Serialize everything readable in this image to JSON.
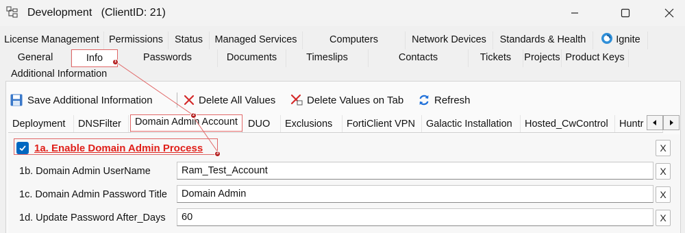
{
  "window": {
    "title": "Development   (ClientID: 21)",
    "app_icon": "tree-icon",
    "controls": [
      "minimize-icon",
      "maximize-icon",
      "close-icon"
    ]
  },
  "tabs_row1": [
    {
      "label": "License Management"
    },
    {
      "label": "Permissions"
    },
    {
      "label": "Status"
    },
    {
      "label": "Managed Services"
    },
    {
      "label": "Computers"
    },
    {
      "label": "Network Devices"
    },
    {
      "label": "Standards & Health"
    },
    {
      "label": "Ignite",
      "icon": "ignite-icon"
    }
  ],
  "tabs_row2": [
    {
      "label": "General"
    },
    {
      "label": "Info",
      "active": true
    },
    {
      "label": "Passwords"
    },
    {
      "label": "Documents"
    },
    {
      "label": "Timeslips"
    },
    {
      "label": "Contacts"
    },
    {
      "label": "Tickets"
    },
    {
      "label": "Projects"
    },
    {
      "label": "Product Keys"
    }
  ],
  "group_label": "Additional Information",
  "toolbar": {
    "save_label": "Save Additional Information",
    "delete_all_label": "Delete All Values",
    "delete_tab_label": "Delete Values on Tab",
    "refresh_label": "Refresh"
  },
  "subtabs": [
    {
      "label": "Deployment"
    },
    {
      "label": "DNSFilter"
    },
    {
      "label": "Domain Admin Account",
      "active": true
    },
    {
      "label": "DUO"
    },
    {
      "label": "Exclusions"
    },
    {
      "label": "FortiClient VPN"
    },
    {
      "label": "Galactic Installation"
    },
    {
      "label": "Hosted_CwControl"
    },
    {
      "label": "Huntr"
    }
  ],
  "form": {
    "enable": {
      "label": "1a. Enable Domain Admin Process",
      "checked": true
    },
    "rows": [
      {
        "label": "1b. Domain Admin UserName",
        "value": "Ram_Test_Account"
      },
      {
        "label": "1c. Domain Admin Password Title",
        "value": "Domain Admin"
      },
      {
        "label": "1d. Update Password After_Days",
        "value": "60"
      }
    ],
    "clear_label": "X"
  },
  "annotations": {
    "markers": [
      "1",
      "2",
      "3"
    ],
    "color": "#b42020"
  },
  "colors": {
    "accent": "#0067c0",
    "highlight_text": "#e0201a",
    "delete_red": "#d42a2a",
    "refresh_blue": "#1e6fd9"
  }
}
